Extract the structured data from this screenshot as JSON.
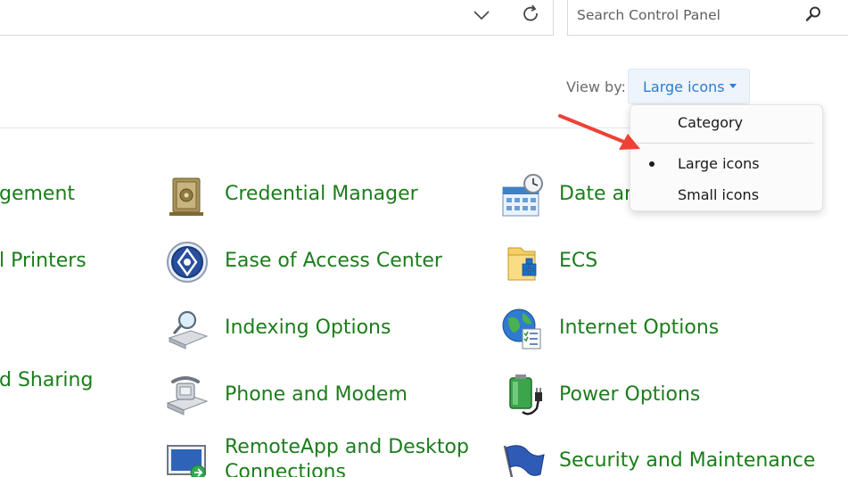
{
  "address_bar": {
    "dropdown_icon": "chevron-down-icon",
    "refresh_icon": "refresh-icon"
  },
  "search": {
    "placeholder": "Search Control Panel",
    "icon": "search-icon"
  },
  "view_by": {
    "label": "View by:",
    "selected": "Large icons",
    "options": [
      {
        "label": "Category",
        "selected": false
      },
      {
        "label": "Large icons",
        "selected": true
      },
      {
        "label": "Small icons",
        "selected": false
      }
    ]
  },
  "items": {
    "col0": [
      "gement",
      "l Printers",
      "d Sharing"
    ],
    "col1": [
      {
        "label": "Credential Manager",
        "icon": "safe-icon"
      },
      {
        "label": "Ease of Access Center",
        "icon": "ease-of-access-icon"
      },
      {
        "label": "Indexing Options",
        "icon": "indexing-magnifier-icon"
      },
      {
        "label": "Phone and Modem",
        "icon": "phone-modem-icon"
      },
      {
        "label": "RemoteApp and Desktop",
        "label2": "Connections",
        "icon": "remote-desktop-icon"
      }
    ],
    "col2": [
      {
        "label": "Date ar",
        "icon": "calendar-clock-icon"
      },
      {
        "label": "ECS",
        "icon": "ecs-folder-icon"
      },
      {
        "label": "Internet Options",
        "icon": "globe-checklist-icon"
      },
      {
        "label": "Power Options",
        "icon": "battery-plug-icon"
      },
      {
        "label": "Security and Maintenance",
        "icon": "flag-icon"
      }
    ]
  },
  "colors": {
    "item_text": "#1b7d1b",
    "link_blue": "#2b7cd3",
    "arrow": "#ef4136"
  }
}
